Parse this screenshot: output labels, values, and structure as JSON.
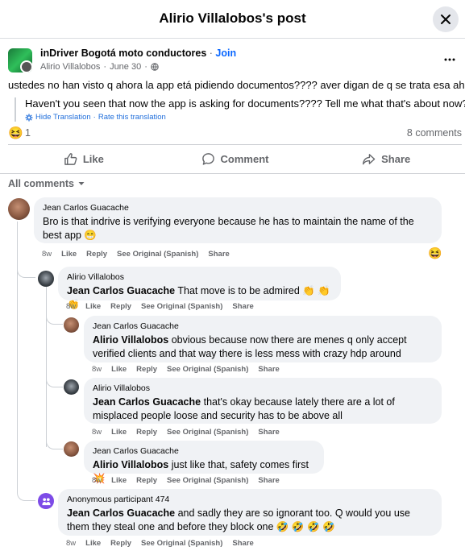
{
  "header": {
    "title": "Alirio Villalobos's post"
  },
  "post": {
    "group_name": "inDriver Bogotá moto conductores",
    "separator": "·",
    "join_label": "Join",
    "author": "Alirio Villalobos",
    "date": "June 30",
    "text": "ustedes no han visto q ahora la app etá pidiendo documentos???? aver digan de q se trata esa ahora?",
    "translation": "Haven't you seen that now the app is asking for documents???? Tell me what that's about now?",
    "hide_translation": "Hide Translation",
    "rate_translation": "Rate this translation",
    "link_separator": "·",
    "reaction_emoji": "😆",
    "reaction_count": "1",
    "comment_count": "8 comments"
  },
  "actions": {
    "like": "Like",
    "comment": "Comment",
    "share": "Share"
  },
  "comments_filter": "All comments",
  "comments": [
    {
      "author": "Jean Carlos Guacache",
      "mention": "",
      "text": "Bro is that indrive is verifying everyone because he has to maintain the name of the best app 😁",
      "time": "8w",
      "reaction": "😆"
    },
    {
      "author": "Alirio Villalobos",
      "mention": "Jean Carlos Guacache",
      "text": "That move is to be admired 👏 👏 👏",
      "time": "8w"
    },
    {
      "author": "Jean Carlos Guacache",
      "mention": "Alirio Villalobos",
      "text": "obvious because now there are menes q only accept verified clients and that way there is less mess with crazy hdp around",
      "time": "8w"
    },
    {
      "author": "Alirio Villalobos",
      "mention": "Jean Carlos Guacache",
      "text": "that's okay because lately there are a lot of misplaced people loose and security has to be above all",
      "time": "8w"
    },
    {
      "author": "Jean Carlos Guacache",
      "mention": "Alirio Villalobos",
      "text": "just like that, safety comes first 💥",
      "time": "8w"
    },
    {
      "author": "Anonymous participant 474",
      "mention": "Jean Carlos Guacache",
      "text": "and sadly they are so ignorant too. Q would you use them they steal one and before they block one 🤣 🤣 🤣 🤣",
      "time": "8w"
    }
  ],
  "comment_actions": {
    "like": "Like",
    "reply": "Reply",
    "see_original": "See Original (Spanish)",
    "share": "Share"
  }
}
